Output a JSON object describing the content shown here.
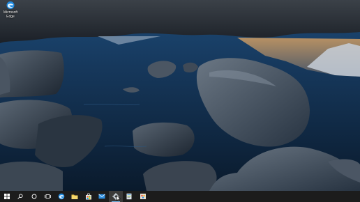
{
  "desktop": {
    "icons": [
      {
        "label": "Microsoft\nEdge",
        "icon": "edge-icon"
      }
    ]
  },
  "taskbar": {
    "items": [
      {
        "name": "start-button",
        "icon": "windows-logo-icon",
        "tooltip": ""
      },
      {
        "name": "search-button",
        "icon": "search-icon"
      },
      {
        "name": "cortana-button",
        "icon": "circle-icon"
      },
      {
        "name": "task-view-button",
        "icon": "task-view-icon"
      },
      {
        "name": "edge-taskbar-button",
        "icon": "edge-icon"
      },
      {
        "name": "file-explorer-button",
        "icon": "folder-icon"
      },
      {
        "name": "store-button",
        "icon": "store-bag-icon"
      },
      {
        "name": "mail-button",
        "icon": "mail-icon"
      },
      {
        "name": "active-app-button",
        "icon": "app-gear-icon"
      },
      {
        "name": "app-button-2",
        "icon": "app-document-icon"
      },
      {
        "name": "app-button-3",
        "icon": "app-paint-icon"
      }
    ]
  },
  "colors": {
    "taskbar": "#1c1c1c",
    "accent": "#76b9ed"
  }
}
